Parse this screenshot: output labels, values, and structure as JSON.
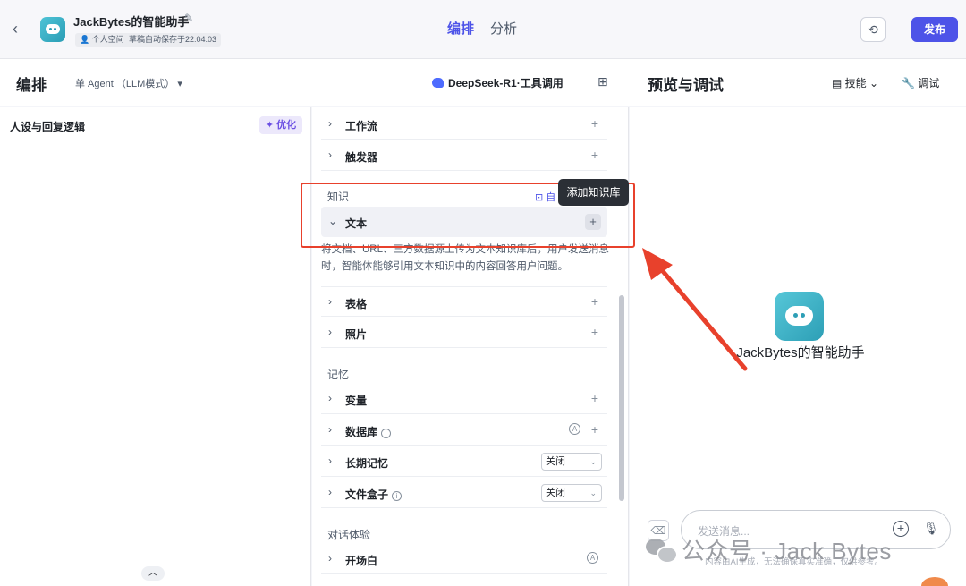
{
  "header": {
    "app_title": "JackBytes的智能助手",
    "space_tag": "个人空间",
    "save_tag": "草稿自动保存于22:04:03",
    "tabs": [
      "编排",
      "分析"
    ],
    "publish_label": "发布",
    "back_icon": "‹",
    "edit_icon": "✎",
    "history_icon": "⟲"
  },
  "subbar": {
    "title": "编排",
    "agent_mode": "单 Agent （LLM模式） ▾",
    "model": "DeepSeek-R1·工具调用",
    "preview_title": "预览与调试",
    "skill_label": "技能 ⌄",
    "debug_label": "调试",
    "grid_icon": "⊞"
  },
  "left": {
    "persona_label": "人设与回复逻辑",
    "optimize_label": "优化",
    "collapse_icon": "︿"
  },
  "middle": {
    "skills": {
      "workflow": "工作流",
      "trigger": "触发器"
    },
    "knowledge": {
      "title": "知识",
      "auto_call": "自",
      "text_label": "文本",
      "description": "将文档、URL、三方数据源上传为文本知识库后，用户发送消息时，智能体能够引用文本知识中的内容回答用户问题。",
      "table_label": "表格",
      "photo_label": "照片"
    },
    "memory": {
      "title": "记忆",
      "variable_label": "变量",
      "database_label": "数据库",
      "long_memory_label": "长期记忆",
      "long_memory_value": "关闭",
      "filebox_label": "文件盒子",
      "filebox_value": "关闭"
    },
    "dialog": {
      "title": "对话体验",
      "opening_label": "开场白"
    },
    "tooltip": "添加知识库"
  },
  "right": {
    "bot_name": "JackBytes的智能助手",
    "input_placeholder": "发送消息...",
    "disclaimer": "内容由AI生成，无法确保真实准确，仅供参考。"
  },
  "watermark": "公众号 · Jack Bytes",
  "colors": {
    "accent": "#4d53e8",
    "highlight": "#e8412c"
  }
}
